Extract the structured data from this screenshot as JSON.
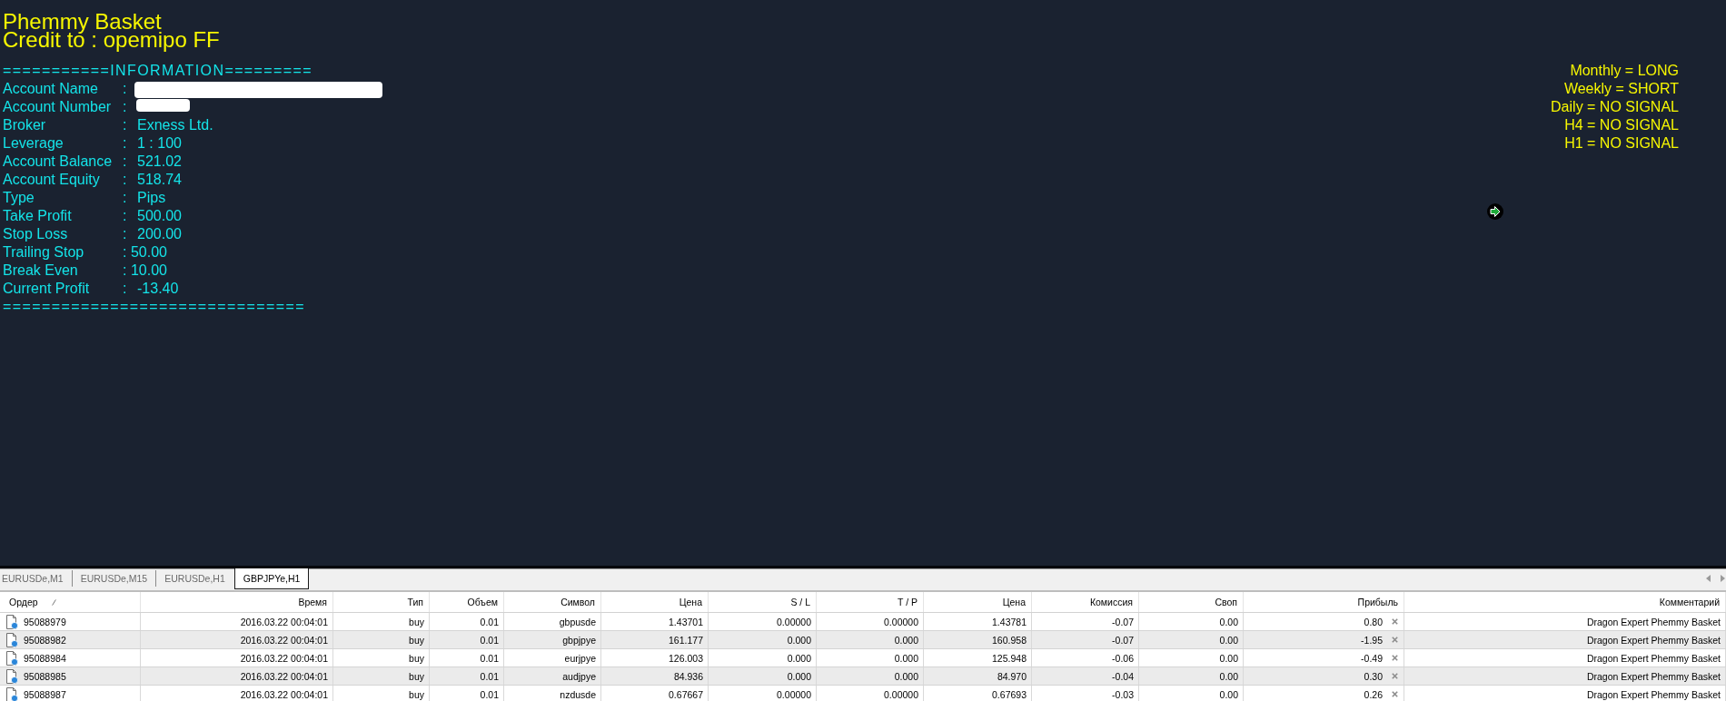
{
  "chart": {
    "title": "Phemmy Basket",
    "credit": "Credit to : opemipo FF",
    "info_header": "===========INFORMATION=========",
    "info_rows": [
      {
        "label": "Account Name",
        "separator": ":",
        "redacted": true
      },
      {
        "label": "Account Number",
        "separator": ":",
        "redacted": true
      },
      {
        "label": "Broker",
        "separator": ":",
        "value": "Exness Ltd.",
        "redacted": false
      },
      {
        "label": "Leverage",
        "separator": ":",
        "value": "1 : 100",
        "redacted": false
      },
      {
        "label": "Account Balance",
        "separator": ":",
        "value": "521.02",
        "redacted": false
      },
      {
        "label": "Account Equity",
        "separator": ":",
        "value": "518.74",
        "redacted": false
      },
      {
        "label": "Type",
        "separator": ":",
        "value": "Pips",
        "redacted": false
      },
      {
        "label": "Take Profit",
        "separator": ":",
        "value": "500.00",
        "redacted": false
      },
      {
        "label": "Stop Loss",
        "separator": ":",
        "value": "200.00",
        "redacted": false
      },
      {
        "label": "Trailing Stop",
        "value": ": 50.00",
        "redacted": false
      },
      {
        "label": "Break Even",
        "value": ": 10.00",
        "redacted": false
      },
      {
        "label": "Current Profit",
        "separator": ":",
        "value": "-13.40",
        "redacted": false
      }
    ],
    "info_footer": "===============================",
    "signals": [
      "Monthly = LONG",
      "Weekly = SHORT",
      "Daily = NO SIGNAL",
      "H4 = NO SIGNAL",
      "H1 = NO SIGNAL"
    ]
  },
  "tabs": [
    {
      "label": "EURUSDe,M1",
      "selected": false
    },
    {
      "label": "EURUSDe,M15",
      "selected": false
    },
    {
      "label": "EURUSDe,H1",
      "selected": false
    },
    {
      "label": "GBPJPYe,H1",
      "selected": true
    }
  ],
  "table": {
    "columns": [
      {
        "label": "Ордер",
        "sorted": true
      },
      {
        "label": "Время",
        "sorted": false
      },
      {
        "label": "Тип",
        "sorted": false
      },
      {
        "label": "Объем",
        "sorted": false
      },
      {
        "label": "Символ",
        "sorted": false
      },
      {
        "label": "Цена",
        "sorted": false
      },
      {
        "label": "S / L",
        "sorted": false
      },
      {
        "label": "T / P",
        "sorted": false
      },
      {
        "label": "Цена",
        "sorted": false
      },
      {
        "label": "Комиссия",
        "sorted": false
      },
      {
        "label": "Своп",
        "sorted": false
      },
      {
        "label": "Прибыль",
        "sorted": false
      },
      {
        "label": "Комментарий",
        "sorted": false
      }
    ],
    "rows": [
      {
        "cells": [
          "95088979",
          "2016.03.22 00:04:01",
          "buy",
          "0.01",
          "gbpusde",
          "1.43701",
          "0.00000",
          "0.00000",
          "1.43781",
          "-0.07",
          "0.00",
          "0.80",
          "Dragon Expert Phemmy Basket"
        ]
      },
      {
        "cells": [
          "95088982",
          "2016.03.22 00:04:01",
          "buy",
          "0.01",
          "gbpjpye",
          "161.177",
          "0.000",
          "0.000",
          "160.958",
          "-0.07",
          "0.00",
          "-1.95",
          "Dragon Expert Phemmy Basket"
        ]
      },
      {
        "cells": [
          "95088984",
          "2016.03.22 00:04:01",
          "buy",
          "0.01",
          "eurjpye",
          "126.003",
          "0.000",
          "0.000",
          "125.948",
          "-0.06",
          "0.00",
          "-0.49",
          "Dragon Expert Phemmy Basket"
        ]
      },
      {
        "cells": [
          "95088985",
          "2016.03.22 00:04:01",
          "buy",
          "0.01",
          "audjpye",
          "84.936",
          "0.000",
          "0.000",
          "84.970",
          "-0.04",
          "0.00",
          "0.30",
          "Dragon Expert Phemmy Basket"
        ]
      },
      {
        "cells": [
          "95088987",
          "2016.03.22 00:04:01",
          "buy",
          "0.01",
          "nzdusde",
          "0.67667",
          "0.00000",
          "0.00000",
          "0.67693",
          "-0.03",
          "0.00",
          "0.26",
          "Dragon Expert Phemmy Basket"
        ]
      }
    ]
  }
}
